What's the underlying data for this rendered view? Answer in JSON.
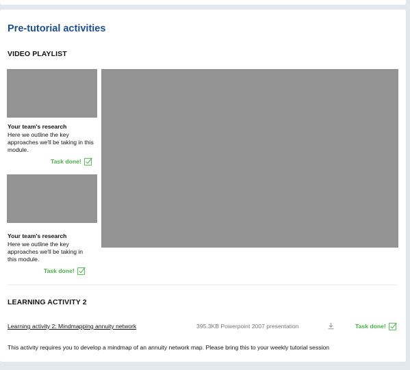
{
  "section": {
    "title": "Pre-tutorial activities"
  },
  "video_playlist": {
    "heading": "VIDEO PLAYLIST",
    "items": [
      {
        "title": "Your team's research",
        "description": "Here we outline the key approaches we'll be taking in this module.",
        "status": "Task done!"
      },
      {
        "title": "Your team's research",
        "description": "Here we outline the key approaches we'll be taking in this module.",
        "status": "Task done!"
      }
    ]
  },
  "learning_activity": {
    "heading": "LEARNING ACTIVITY 2",
    "file_link": "Learning activity 2: Mindmapping annuity network",
    "file_meta": "395.3KB Powerpoint 2007 presentation",
    "status": "Task done!",
    "description": "This activity requires you to develop a mindmap of an annuity network map. Please bring this to your weekly tutorial session"
  },
  "icons": {
    "check": "checkbox-check-icon",
    "download": "download-icon"
  },
  "colors": {
    "background": "#e3e8ef",
    "title": "#1f4e8c",
    "success": "#44b244",
    "video_placeholder": "#939393",
    "muted_text": "#777777"
  }
}
